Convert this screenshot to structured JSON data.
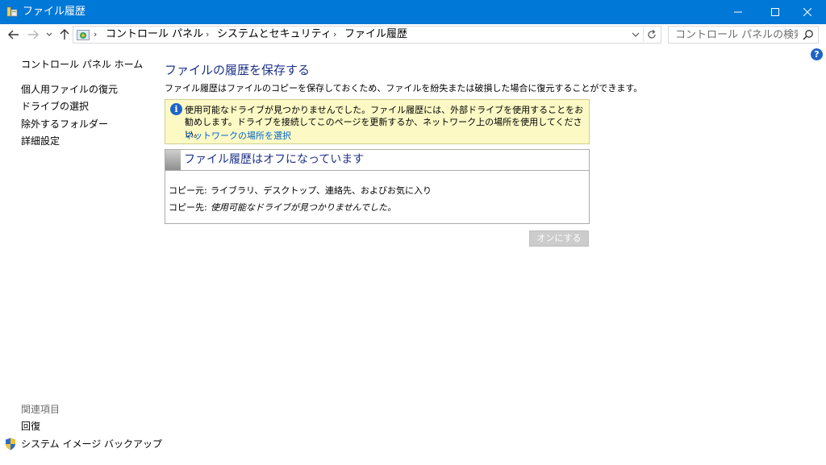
{
  "window": {
    "title": "ファイル履歴"
  },
  "breadcrumb": [
    "コントロール パネル",
    "システムとセキュリティ",
    "ファイル履歴"
  ],
  "search": {
    "placeholder": "コントロール パネルの検索"
  },
  "help": {
    "label": "?"
  },
  "sidebar": {
    "home": "コントロール パネル ホーム",
    "items": [
      "個人用ファイルの復元",
      "ドライブの選択",
      "除外するフォルダー",
      "詳細設定"
    ],
    "related_title": "関連項目",
    "related": [
      "回復",
      "システム イメージ バックアップ"
    ]
  },
  "main": {
    "heading": "ファイルの履歴を保存する",
    "description": "ファイル履歴はファイルのコピーを保存しておくため、ファイルを紛失または破損した場合に復元することができます。",
    "warning": {
      "icon": "info-icon",
      "message": "使用可能なドライブが見つかりませんでした。ファイル履歴には、外部ドライブを使用することをお勧めします。ドライブを接続してこのページを更新するか、ネットワーク上の場所を使用してください。",
      "link": "ネットワークの場所を選択"
    },
    "status": {
      "title": "ファイル履歴はオフになっています",
      "copy_from_label": "コピー元:",
      "copy_from_value": "ライブラリ、デスクトップ、連絡先、およびお気に入り",
      "copy_to_label": "コピー先:",
      "copy_to_value": "使用可能なドライブが見つかりませんでした。"
    },
    "turn_on_button": "オンにする"
  },
  "colors": {
    "titlebar": "#0078d7",
    "heading": "#1e3287",
    "link": "#0066cc",
    "warning_bg": "#fcf9c5",
    "disabled_button": "#cccccc"
  }
}
